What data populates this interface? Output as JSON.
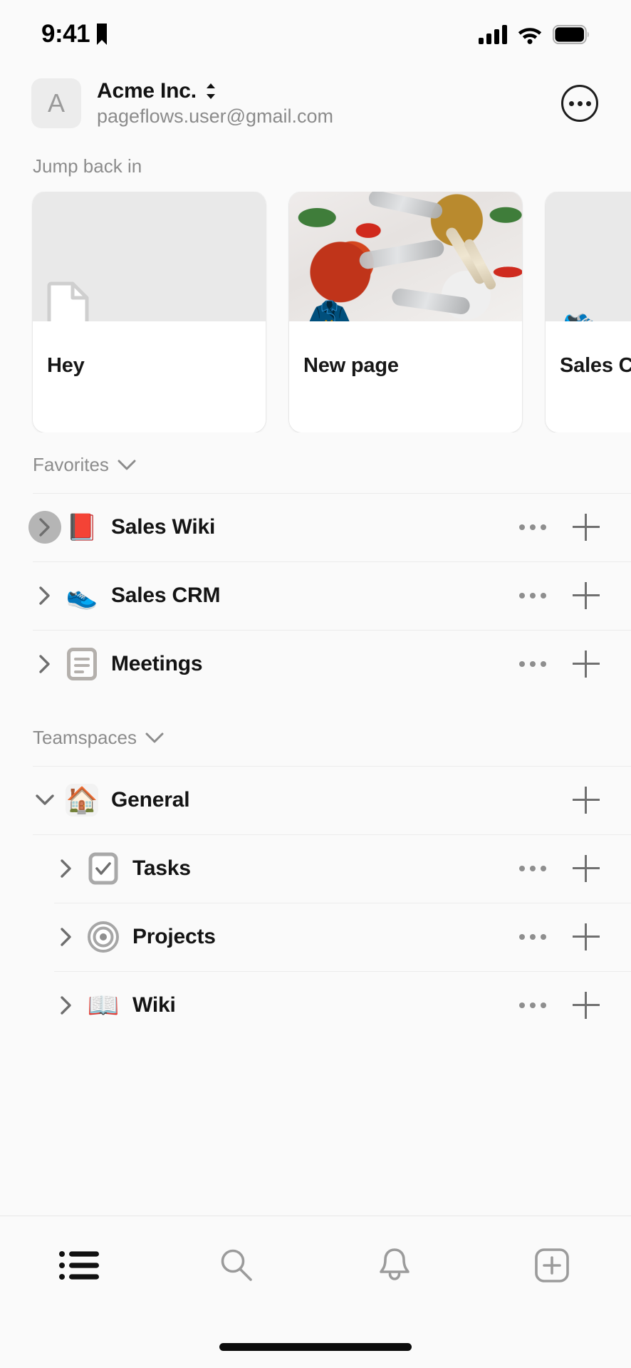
{
  "status_bar": {
    "time": "9:41",
    "icons": [
      "bookmark-icon",
      "cellular-signal-icon",
      "wifi-icon",
      "battery-icon"
    ]
  },
  "account": {
    "avatar_initial": "A",
    "workspace_name": "Acme Inc.",
    "switcher_icon": "chevron-up-down-icon",
    "email": "pageflows.user@gmail.com",
    "more_icon": "ellipsis-circle-icon"
  },
  "jump_back_in": {
    "title": "Jump back in",
    "cards": [
      {
        "title": "Hey",
        "cover": "blank",
        "icon": "page-icon"
      },
      {
        "title": "New page",
        "cover": "spices-photo",
        "icon": "clothes-hanger-emoji"
      },
      {
        "title": "Sales C",
        "cover": "blank",
        "icon": "running-shoe-emoji"
      }
    ]
  },
  "favorites": {
    "title": "Favorites",
    "collapse_icon": "chevron-down-icon",
    "items": [
      {
        "label": "Sales Wiki",
        "icon": "closed-book-emoji",
        "expand_icon": "chevron-right-icon",
        "expanded": false,
        "pressed": true,
        "has_more": true,
        "has_add": true
      },
      {
        "label": "Sales CRM",
        "icon": "running-shoe-emoji",
        "expand_icon": "chevron-right-icon",
        "expanded": false,
        "pressed": false,
        "has_more": true,
        "has_add": true
      },
      {
        "label": "Meetings",
        "icon": "note-card-icon",
        "expand_icon": "chevron-right-icon",
        "expanded": false,
        "pressed": false,
        "has_more": true,
        "has_add": true
      }
    ]
  },
  "teamspaces": {
    "title": "Teamspaces",
    "collapse_icon": "chevron-down-icon",
    "items": [
      {
        "label": "General",
        "icon": "house-emoji",
        "expand_icon": "chevron-down-icon",
        "expanded": true,
        "indent": false,
        "has_more": false,
        "has_add": true
      },
      {
        "label": "Tasks",
        "icon": "checkbox-icon",
        "expand_icon": "chevron-right-icon",
        "expanded": false,
        "indent": true,
        "has_more": true,
        "has_add": true
      },
      {
        "label": "Projects",
        "icon": "bullseye-icon",
        "expand_icon": "chevron-right-icon",
        "expanded": false,
        "indent": true,
        "has_more": true,
        "has_add": true
      },
      {
        "label": "Wiki",
        "icon": "open-book-emoji",
        "expand_icon": "chevron-right-icon",
        "expanded": false,
        "indent": true,
        "has_more": true,
        "has_add": true
      }
    ]
  },
  "tab_bar": {
    "tabs": [
      {
        "name": "list",
        "icon": "bullet-list-icon",
        "active": true
      },
      {
        "name": "search",
        "icon": "search-icon",
        "active": false
      },
      {
        "name": "inbox",
        "icon": "bell-icon",
        "active": false
      },
      {
        "name": "new",
        "icon": "plus-square-icon",
        "active": false
      }
    ]
  },
  "colors": {
    "background": "#fafafa",
    "card_background": "#ffffff",
    "text_primary": "#141414",
    "text_secondary": "#8c8c8c",
    "separator": "#ececec",
    "accent_house": "#e8802a",
    "accent_book": "#c8222e",
    "active_tab": "#111111",
    "inactive_tab": "#9a9a9a"
  }
}
